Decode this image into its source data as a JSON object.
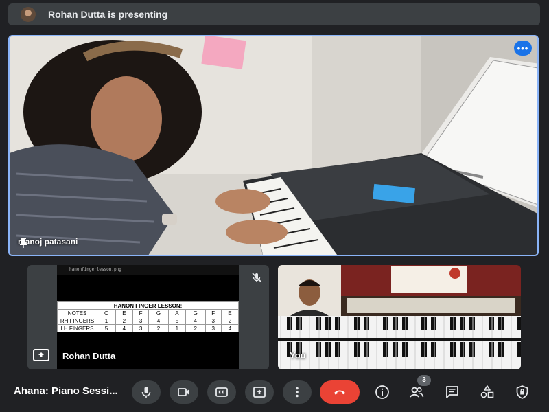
{
  "presenting_bar": {
    "text": "Rohan Dutta is presenting"
  },
  "main_video": {
    "participant": "manoj patasani",
    "more_label": "•••"
  },
  "presentation": {
    "url": "hanonfingerlesson.png",
    "table_title": "HANON FINGER LESSON:",
    "header_row": {
      "label": "NOTES",
      "cells": [
        "C",
        "E",
        "F",
        "G",
        "A",
        "G",
        "F",
        "E"
      ]
    },
    "rows": [
      {
        "label": "RH FINGERS",
        "cells": [
          "1",
          "2",
          "3",
          "4",
          "5",
          "4",
          "3",
          "2"
        ]
      },
      {
        "label": "LH FINGERS",
        "cells": [
          "5",
          "4",
          "3",
          "2",
          "1",
          "2",
          "3",
          "4"
        ]
      }
    ],
    "presenter_name": "Rohan Dutta"
  },
  "self_view": {
    "label": "You"
  },
  "bottom_bar": {
    "meeting_name": "Ahana: Piano Sessi...",
    "participant_count": "3"
  },
  "colors": {
    "accent": "#8ab4f8",
    "end_call": "#ea4335",
    "highlight": "#f5b301"
  }
}
